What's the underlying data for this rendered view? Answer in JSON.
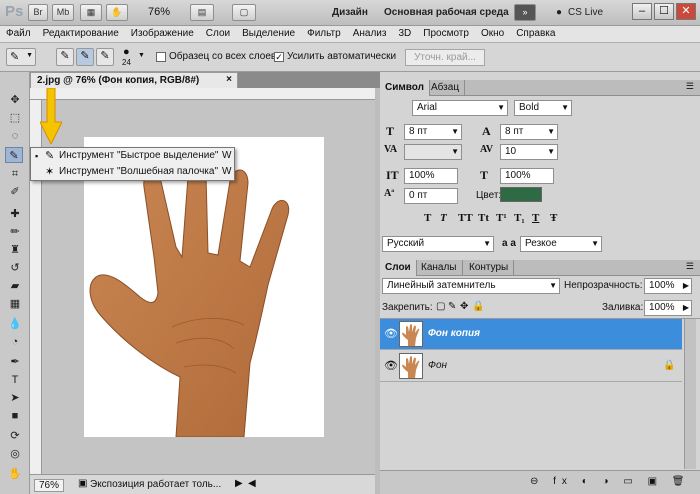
{
  "appbar": {
    "logo": "Ps",
    "btn_br": "Br",
    "btn_mb": "Mb",
    "zoom": "76%",
    "workspace_design": "Дизайн",
    "workspace_main": "Основная рабочая среда",
    "expand": "»",
    "cs_live": "CS Live",
    "win_min": "–",
    "win_max": "☐",
    "win_close": "✕"
  },
  "menu": [
    "Файл",
    "Редактирование",
    "Изображение",
    "Слои",
    "Выделение",
    "Фильтр",
    "Анализ",
    "3D",
    "Просмотр",
    "Окно",
    "Справка"
  ],
  "options": {
    "brush_size": "24",
    "sample_all_layers": "Образец со всех слоев",
    "sample_all_checked": "",
    "auto_enhance": "Усилить автоматически",
    "auto_enhance_checked": "✓",
    "refine_edge": "Уточн. край..."
  },
  "document": {
    "tab_title": "2.jpg @ 76% (Фон копия, RGB/8#)",
    "tab_close": "×",
    "status_zoom": "76%",
    "status_text": "Экспозиция работает толь..."
  },
  "flyout": {
    "items": [
      {
        "bullet": "▪",
        "label": "Инструмент \"Быстрое выделение\"",
        "key": "W"
      },
      {
        "bullet": "",
        "label": "Инструмент \"Волшебная палочка\"",
        "key": "W"
      }
    ]
  },
  "character_panel": {
    "tab_character": "Символ",
    "tab_paragraph": "Абзац",
    "font_family": "Arial",
    "font_style": "Bold",
    "font_size": "8 пт",
    "leading": "8 пт",
    "kerning": "",
    "tracking": "10",
    "vscale": "100%",
    "hscale": "100%",
    "baseline": "0 пт",
    "color_label": "Цвет:",
    "color": "#2e6b45",
    "text_styles": [
      "T",
      "T",
      "TT",
      "Tt",
      "T¹",
      "T₁",
      "T",
      "Ŧ"
    ],
    "language": "Русский",
    "aa_label": "a a",
    "antialias": "Резкое"
  },
  "layers_panel": {
    "tab_layers": "Слои",
    "tab_channels": "Каналы",
    "tab_paths": "Контуры",
    "blend_mode": "Линейный затемнитель",
    "opacity_label": "Непрозрачность:",
    "opacity": "100%",
    "lock_label": "Закрепить:",
    "fill_label": "Заливка:",
    "fill": "100%",
    "layers": [
      {
        "name": "Фон копия",
        "active": true,
        "locked": false
      },
      {
        "name": "Фон",
        "active": false,
        "locked": true
      }
    ],
    "footer_icons": "⊖ fx ◐ ◑ ▭ ▣ 🗑"
  },
  "colors": {
    "selection_blue": "#3c8ddc",
    "arrow": "#f5c400"
  }
}
